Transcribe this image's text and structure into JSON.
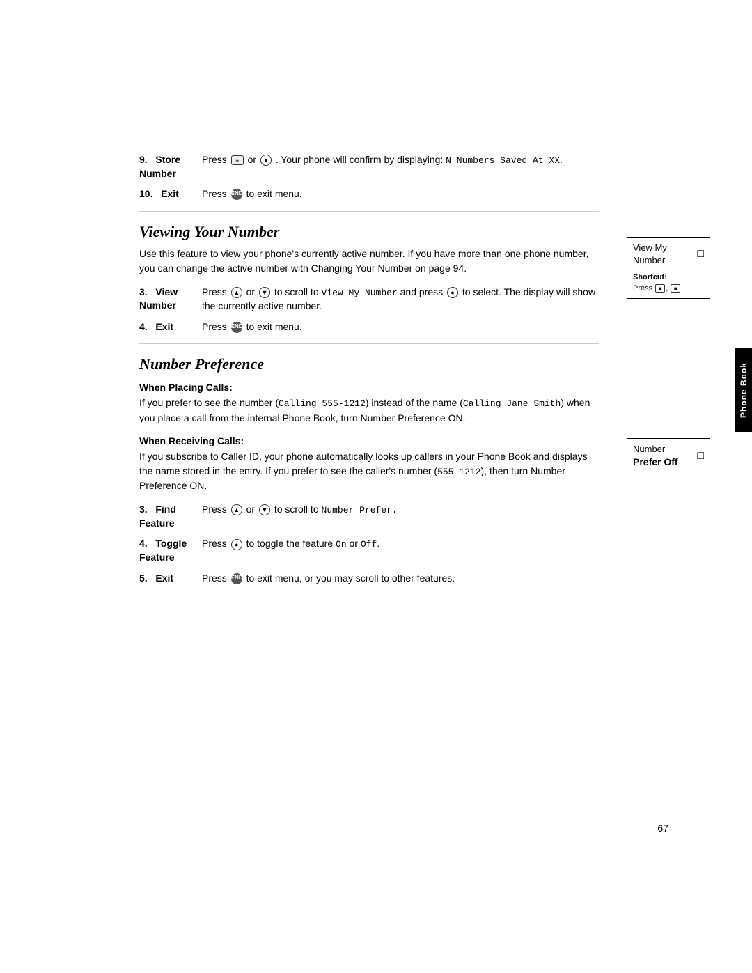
{
  "page": {
    "number": "67",
    "background": "#ffffff"
  },
  "section_store": {
    "step9_label": "9.",
    "step9_sublabel": "Store",
    "step9_bold": "Number",
    "step9_text": "Press",
    "step9_or": "or",
    "step9_rest": ". Your phone will confirm by displaying:",
    "step9_code": "N Numbers Saved At XX",
    "step9_code_dot": ".",
    "step10_label": "10.",
    "step10_sublabel": "Exit",
    "step10_text": "Press",
    "step10_rest": "to exit menu."
  },
  "viewing_your_number": {
    "title": "Viewing Your Number",
    "intro": "Use this feature to view your phone's currently active number. If you have more than one phone number, you can change the active number with Changing Your Number on page 94.",
    "step3_label": "3.",
    "step3_sublabel": "View",
    "step3_bold": "Number",
    "step3_text": "Press",
    "step3_or": "or",
    "step3_rest1": "to scroll to",
    "step3_code": "View My Number",
    "step3_rest2": "and press",
    "step3_rest3": "to select. The display will show the currently active number.",
    "step4_label": "4.",
    "step4_sublabel": "Exit",
    "step4_text": "Press",
    "step4_rest": "to exit menu.",
    "sidebar_line1": "View My",
    "sidebar_line2": "Number",
    "sidebar_icon": "□",
    "shortcut_label": "Shortcut:",
    "shortcut_text": "Press",
    "shortcut_icons": "■, ■"
  },
  "number_preference": {
    "title": "Number Preference",
    "sidebar_line1": "Number",
    "sidebar_line2": "Prefer Off",
    "sidebar_icon": "□",
    "when_placing_calls_heading": "When Placing Calls:",
    "when_placing_calls_text": "If you prefer to see the number (Calling 555-1212) instead of the name (Calling Jane Smith) when you place a call from the internal Phone Book, turn Number Preference ON.",
    "when_receiving_calls_heading": "When Receiving Calls:",
    "when_receiving_calls_text": "If you subscribe to Caller ID, your phone automatically looks up callers in your Phone Book and displays the name stored in the entry. If you prefer to see the caller's number (555-1212), then turn Number Preference ON.",
    "step3_label": "3.",
    "step3_sublabel": "Find",
    "step3_bold": "Feature",
    "step3_text": "Press",
    "step3_or": "or",
    "step3_rest": "to scroll to",
    "step3_code": "Number Prefer.",
    "step4_label": "4.",
    "step4_sublabel": "Toggle",
    "step4_bold": "Feature",
    "step4_text": "Press",
    "step4_rest": "to toggle the feature",
    "step4_code1": "On",
    "step4_or": "or",
    "step4_code2": "Off",
    "step4_dot": ".",
    "step5_label": "5.",
    "step5_sublabel": "Exit",
    "step5_text": "Press",
    "step5_rest": "to exit menu, or you may scroll to other features."
  },
  "phone_book_tab": "Phone Book"
}
